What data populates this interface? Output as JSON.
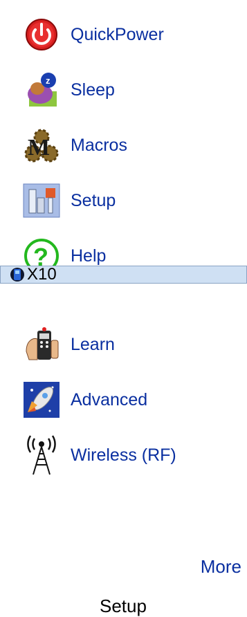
{
  "menu": {
    "items": [
      {
        "label": "QuickPower",
        "icon": "power-icon"
      },
      {
        "label": "Sleep",
        "icon": "sleep-icon"
      },
      {
        "label": "Macros",
        "icon": "macros-icon"
      },
      {
        "label": "Setup",
        "icon": "setup-icon"
      },
      {
        "label": "Help",
        "icon": "help-icon"
      },
      {
        "label": "X10",
        "icon": "x10-remote-icon",
        "selected": true
      },
      {
        "label": "Learn",
        "icon": "learn-icon"
      },
      {
        "label": "Advanced",
        "icon": "advanced-icon"
      },
      {
        "label": "Wireless (RF)",
        "icon": "wireless-antenna-icon"
      }
    ]
  },
  "softkeys": {
    "more_label": "More",
    "title": "Setup"
  },
  "colors": {
    "label_text": "#0a2fa0",
    "selected_background": "#cfe0f3",
    "selected_border": "#8aa3c3"
  }
}
